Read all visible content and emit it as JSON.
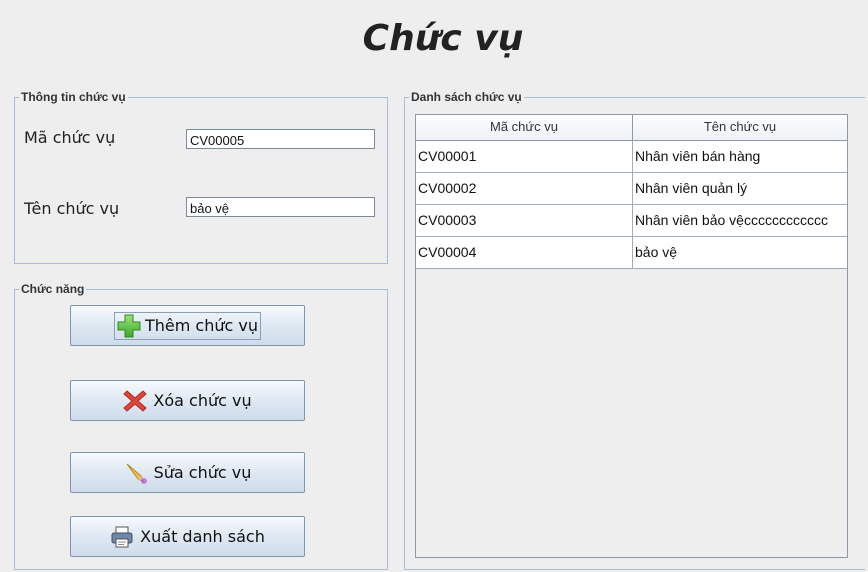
{
  "page_title": "Chức vụ",
  "info_group": {
    "legend": "Thông tin chức vụ",
    "code_label": "Mã chức vụ",
    "code_value": "CV00005",
    "name_label": "Tên chức vụ",
    "name_value": "bảo vệ"
  },
  "function_group": {
    "legend": "Chức năng",
    "add_label": "Thêm chức vụ",
    "delete_label": "Xóa chức vụ",
    "edit_label": "Sửa chức vụ",
    "export_label": "Xuất danh sách"
  },
  "list_group": {
    "legend": "Danh sách chức vụ",
    "columns": [
      "Mã chức vụ",
      "Tên chức vụ"
    ],
    "rows": [
      [
        "CV00001",
        "Nhân viên bán hàng"
      ],
      [
        "CV00002",
        "Nhân viên quản lý"
      ],
      [
        "CV00003",
        "Nhân viên bảo vệcccccccccccc"
      ],
      [
        "CV00004",
        "bảo vệ"
      ]
    ]
  },
  "colors": {
    "background": "#eeeeee",
    "group_border": "#a9bcd4",
    "button_gradient_top": "#f7fafd",
    "button_gradient_bottom": "#cfdcea",
    "add_icon": "#5cc43a",
    "delete_icon": "#e0453a"
  },
  "icons": {
    "add": "plus-icon",
    "delete": "x-icon",
    "edit": "pencil-icon",
    "export": "printer-icon"
  }
}
